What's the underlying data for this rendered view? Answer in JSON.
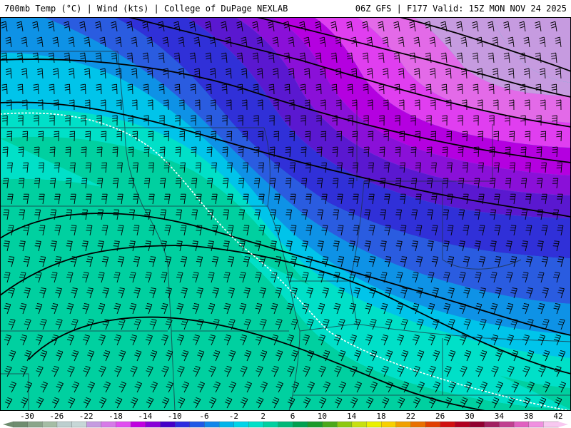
{
  "header": {
    "left_title": "700mb Temp (°C) | Wind (kts) | College of DuPage NEXLAB",
    "right_title": "06Z GFS | F177 Valid: 15Z MON NOV 24 2025"
  },
  "colorbar": {
    "labels": [
      "-30",
      "-26",
      "-22",
      "-18",
      "-14",
      "-10",
      "-6",
      "-2",
      "2",
      "6",
      "10",
      "14",
      "18",
      "22",
      "26",
      "30",
      "34",
      "38",
      "42"
    ],
    "colors": [
      "#6f8c6f",
      "#8aa58a",
      "#a5bda5",
      "#bdcfcf",
      "#c7d7d7",
      "#c59be0",
      "#d67ae8",
      "#e04ef0",
      "#c000e0",
      "#8800d8",
      "#4400c8",
      "#2c2ce0",
      "#1e58e6",
      "#0e86ea",
      "#00b4ea",
      "#00d4e8",
      "#00e0c8",
      "#00d0a0",
      "#00b878",
      "#00a050",
      "#1a9a2a",
      "#4aa81a",
      "#8cc810",
      "#c8e010",
      "#eaf000",
      "#f8d000",
      "#f0a000",
      "#e87000",
      "#e04000",
      "#d01010",
      "#b00020",
      "#900030",
      "#a02060",
      "#c04090",
      "#e060c0",
      "#f090e0",
      "#f8c8f0"
    ]
  }
}
